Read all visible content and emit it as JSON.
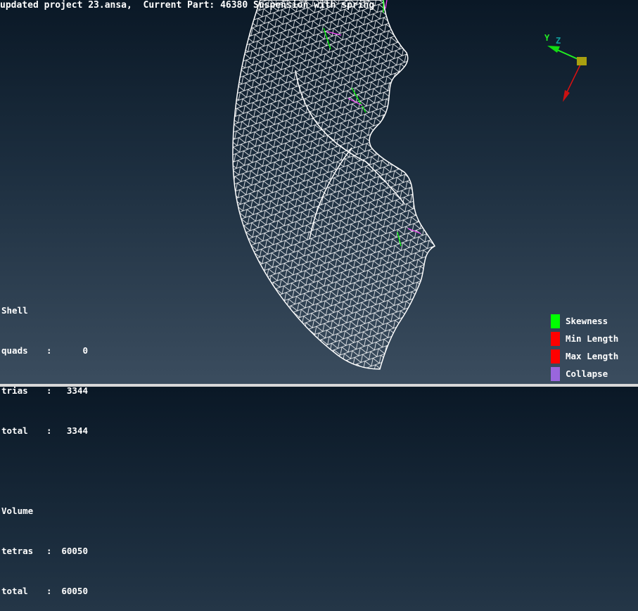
{
  "header": {
    "title": "updated project 23.ansa,  Current Part: 46380 Suspension with spring"
  },
  "axes": {
    "y_label": "Y",
    "z_label": "Z"
  },
  "stats": {
    "shell_heading": "Shell",
    "shell_rows": [
      {
        "label": "quads",
        "value": "0"
      },
      {
        "label": "trias",
        "value": "3344"
      },
      {
        "label": "total",
        "value": "3344"
      }
    ],
    "volume_heading": "Volume",
    "volume_rows": [
      {
        "label": "tetras",
        "value": "60050"
      },
      {
        "label": "total",
        "value": "60050"
      }
    ],
    "separator": ":"
  },
  "legend": [
    {
      "label": "Skewness",
      "color": "#00ff00"
    },
    {
      "label": "Min Length",
      "color": "#ff0000"
    },
    {
      "label": "Max Length",
      "color": "#ff0000"
    },
    {
      "label": "Collapse",
      "color": "#9966dd"
    }
  ]
}
